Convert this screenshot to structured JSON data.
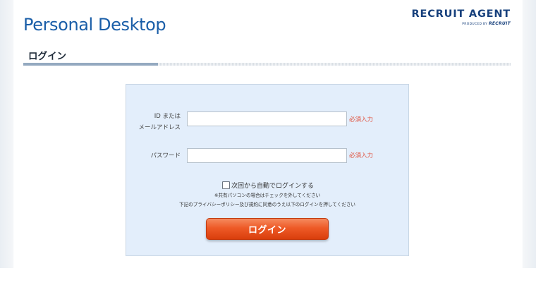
{
  "header": {
    "logo_text": "Personal Desktop",
    "brand_name": "RECRUIT AGENT",
    "brand_sub_prefix": "PRODUCED BY",
    "brand_sub_company": "RECRUIT"
  },
  "section": {
    "title": "ログイン"
  },
  "form": {
    "id_label_line1": "ID または",
    "id_label_line2": "メールアドレス",
    "id_value": "",
    "password_label": "パスワード",
    "password_value": "",
    "required_label": "必須入力",
    "auto_login_label": "次回から自動でログインする",
    "auto_login_checked": false,
    "note_shared_pc": "※共有パソコンの場合はチェックを外してください",
    "note_privacy": "下記のプライバシーポリシー及び規約に同意のうえ以下のログインを押してください",
    "login_button_label": "ログイン"
  },
  "colors": {
    "logo": "#1a5ea8",
    "brand": "#17407c",
    "required": "#e0503c",
    "box_background": "#e3eefb",
    "button": "#ee5a27"
  }
}
